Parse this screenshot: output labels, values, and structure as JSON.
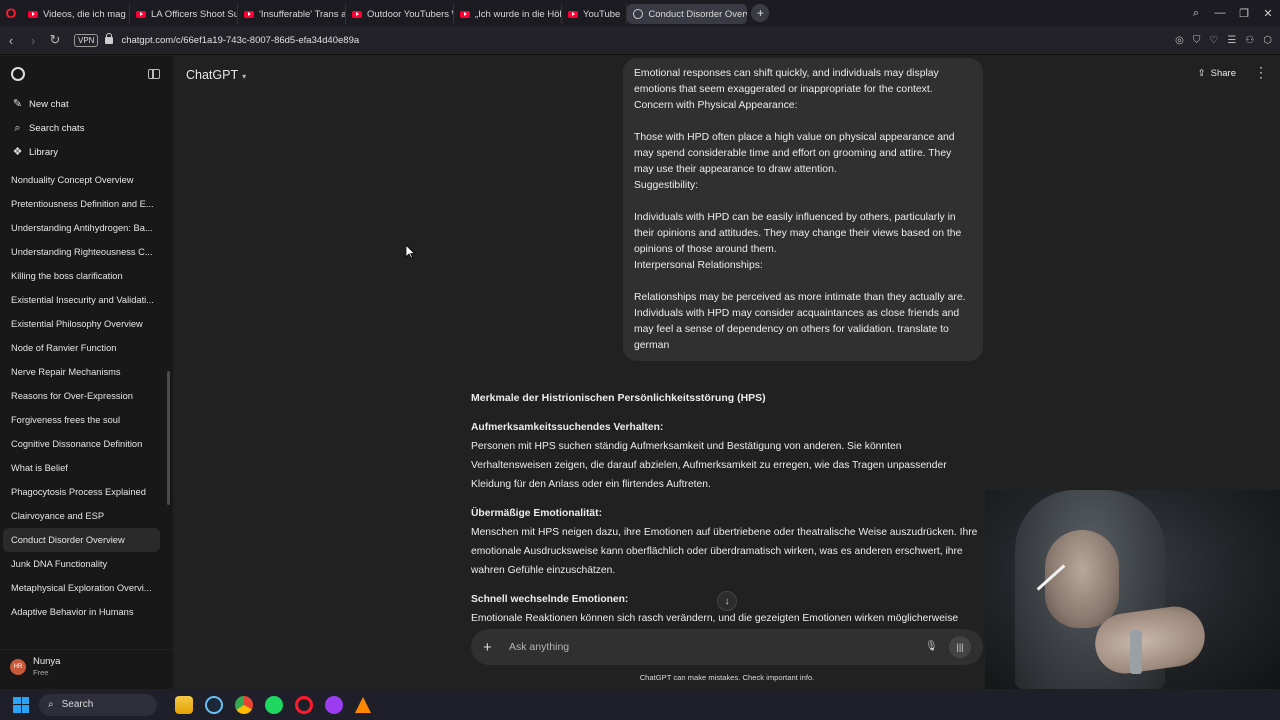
{
  "browser": {
    "tabs": [
      {
        "label": "Videos, die ich mag - You",
        "kind": "youtube"
      },
      {
        "label": "LA Officers Shoot Suspect",
        "kind": "youtube"
      },
      {
        "label": "'Insufferable' Trans activist",
        "kind": "youtube"
      },
      {
        "label": "Outdoor YouTubers Who",
        "kind": "youtube"
      },
      {
        "label": "„Ich wurde in die Hölle ge",
        "kind": "youtube"
      },
      {
        "label": "YouTube",
        "kind": "youtube"
      },
      {
        "label": "Conduct Disorder Overvie",
        "kind": "chatgpt",
        "active": true
      }
    ],
    "vpn_label": "VPN",
    "url": "chatgpt.com/c/66ef1a19-743c-8007-86d5-efa34d40e89a"
  },
  "sidebar": {
    "actions": {
      "new_chat": "New chat",
      "search_chats": "Search chats",
      "library": "Library"
    },
    "history": [
      "Nonduality Concept Overview",
      "Pretentiousness Definition and E...",
      "Understanding Antihydrogen: Ba...",
      "Understanding Righteousness C...",
      "Killing the boss clarification",
      "Existential Insecurity and Validati...",
      "Existential Philosophy Overview",
      "Node of Ranvier Function",
      "Nerve Repair Mechanisms",
      "Reasons for Over-Expression",
      "Forgiveness frees the soul",
      "Cognitive Dissonance Definition",
      "What is Belief",
      "Phagocytosis Process Explained",
      "Clairvoyance and ESP",
      "Conduct Disorder Overview",
      "Junk DNA Functionality",
      "Metaphysical Exploration Overvi...",
      "Adaptive Behavior in Humans"
    ],
    "active_index": 15,
    "user": {
      "initials": "HR",
      "name": "Nunya",
      "plan": "Free"
    }
  },
  "header": {
    "model": "ChatGPT",
    "share": "Share"
  },
  "user_message": [
    "Emotional responses can shift quickly, and individuals may display emotions that seem exaggerated or inappropriate for the context.",
    "Concern with Physical Appearance:",
    "",
    "Those with HPD often place a high value on physical appearance and may spend considerable time and effort on grooming and attire. They may use their appearance to draw attention.",
    "Suggestibility:",
    "",
    "Individuals with HPD can be easily influenced by others, particularly in their opinions and attitudes. They may change their views based on the opinions of those around them.",
    "Interpersonal Relationships:",
    "",
    "Relationships may be perceived as more intimate than they actually are. Individuals with HPD may consider acquaintances as close friends and may feel a sense of dependency on others for validation. translate to german"
  ],
  "answer": {
    "heading": "Merkmale der Histrionischen Persönlichkeitsstörung (HPS)",
    "sections": [
      {
        "title": "Aufmerksamkeitssuchendes Verhalten:",
        "body": "Personen mit HPS suchen ständig Aufmerksamkeit und Bestätigung von anderen. Sie könnten Verhaltensweisen zeigen, die darauf abzielen, Aufmerksamkeit zu erregen, wie das Tragen unpassender Kleidung für den Anlass oder ein flirtendes Auftreten."
      },
      {
        "title": "Übermäßige Emotionalität:",
        "body": "Menschen mit HPS neigen dazu, ihre Emotionen auf übertriebene oder theatralische Weise auszudrücken. Ihre emotionale Ausdrucksweise kann oberflächlich oder überdramatisch wirken, was es anderen erschwert, ihre wahren Gefühle einzuschätzen."
      },
      {
        "title": "Schnell wechselnde Emotionen:",
        "body": "Emotionale Reaktionen können sich rasch verändern, und die gezeigten Emotionen wirken möglicherweise"
      }
    ]
  },
  "composer": {
    "placeholder": "Ask anything",
    "disclaimer": "ChatGPT can make mistakes. Check important info."
  },
  "taskbar": {
    "search_label": "Search"
  }
}
